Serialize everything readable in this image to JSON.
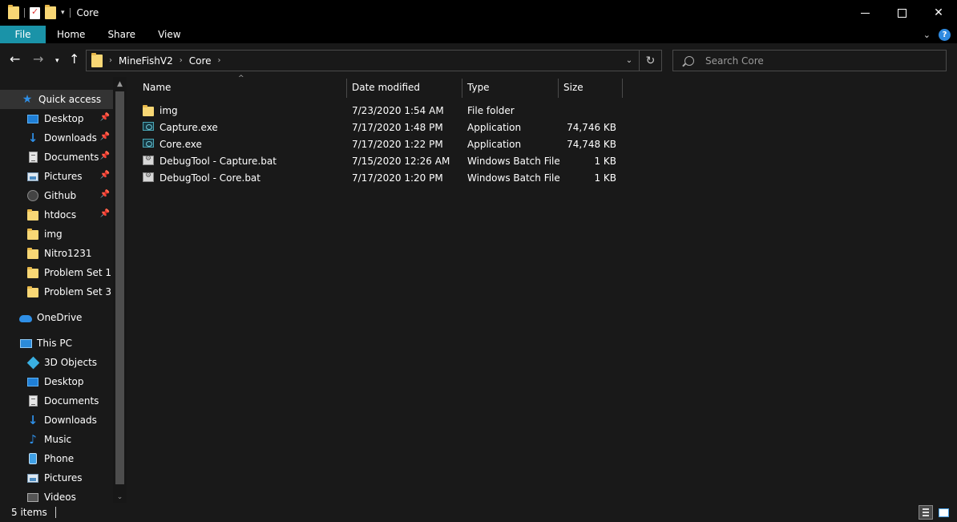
{
  "window": {
    "title": "Core",
    "controls": {
      "minimize": "minimize-icon",
      "maximize": "maximize-icon",
      "close": "✕"
    }
  },
  "ribbon": {
    "tabs": [
      {
        "label": "File",
        "active": true
      },
      {
        "label": "Home"
      },
      {
        "label": "Share"
      },
      {
        "label": "View"
      }
    ],
    "help": "?"
  },
  "address": {
    "breadcrumb": [
      "MineFishV2",
      "Core"
    ]
  },
  "search": {
    "placeholder": "Search Core"
  },
  "nav": {
    "quick_access": {
      "label": "Quick access",
      "items": [
        {
          "label": "Desktop",
          "icon": "desktop-icon",
          "pinned": true
        },
        {
          "label": "Downloads",
          "icon": "download-icon",
          "pinned": true
        },
        {
          "label": "Documents",
          "icon": "document-icon",
          "pinned": true
        },
        {
          "label": "Pictures",
          "icon": "pictures-icon",
          "pinned": true
        },
        {
          "label": "Github",
          "icon": "github-icon",
          "pinned": true
        },
        {
          "label": "htdocs",
          "icon": "folder-icon",
          "pinned": true
        },
        {
          "label": "img",
          "icon": "folder-icon",
          "pinned": false
        },
        {
          "label": "Nitro1231",
          "icon": "folder-icon",
          "pinned": false
        },
        {
          "label": "Problem Set 1",
          "icon": "folder-icon",
          "pinned": false
        },
        {
          "label": "Problem Set 3",
          "icon": "folder-icon",
          "pinned": false
        }
      ]
    },
    "onedrive": {
      "label": "OneDrive"
    },
    "this_pc": {
      "label": "This PC",
      "items": [
        {
          "label": "3D Objects",
          "icon": "3d-objects-icon"
        },
        {
          "label": "Desktop",
          "icon": "desktop-icon"
        },
        {
          "label": "Documents",
          "icon": "document-icon"
        },
        {
          "label": "Downloads",
          "icon": "download-icon"
        },
        {
          "label": "Music",
          "icon": "music-icon"
        },
        {
          "label": "Phone",
          "icon": "phone-icon"
        },
        {
          "label": "Pictures",
          "icon": "pictures-icon"
        },
        {
          "label": "Videos",
          "icon": "videos-icon"
        }
      ]
    }
  },
  "columns": {
    "name": "Name",
    "date": "Date modified",
    "type": "Type",
    "size": "Size"
  },
  "files": [
    {
      "name": "img",
      "date": "7/23/2020 1:54 AM",
      "type": "File folder",
      "size": "",
      "icon": "folder-icon"
    },
    {
      "name": "Capture.exe",
      "date": "7/17/2020 1:48 PM",
      "type": "Application",
      "size": "74,746 KB",
      "icon": "application-icon"
    },
    {
      "name": "Core.exe",
      "date": "7/17/2020 1:22 PM",
      "type": "Application",
      "size": "74,748 KB",
      "icon": "application-icon"
    },
    {
      "name": "DebugTool - Capture.bat",
      "date": "7/15/2020 12:26 AM",
      "type": "Windows Batch File",
      "size": "1 KB",
      "icon": "batch-file-icon"
    },
    {
      "name": "DebugTool - Core.bat",
      "date": "7/17/2020 1:20 PM",
      "type": "Windows Batch File",
      "size": "1 KB",
      "icon": "batch-file-icon"
    }
  ],
  "status": {
    "item_count": "5 items"
  },
  "colors": {
    "accent": "#1a93a8",
    "background": "#191919",
    "titlebar": "#000000",
    "selection": "#333333"
  }
}
